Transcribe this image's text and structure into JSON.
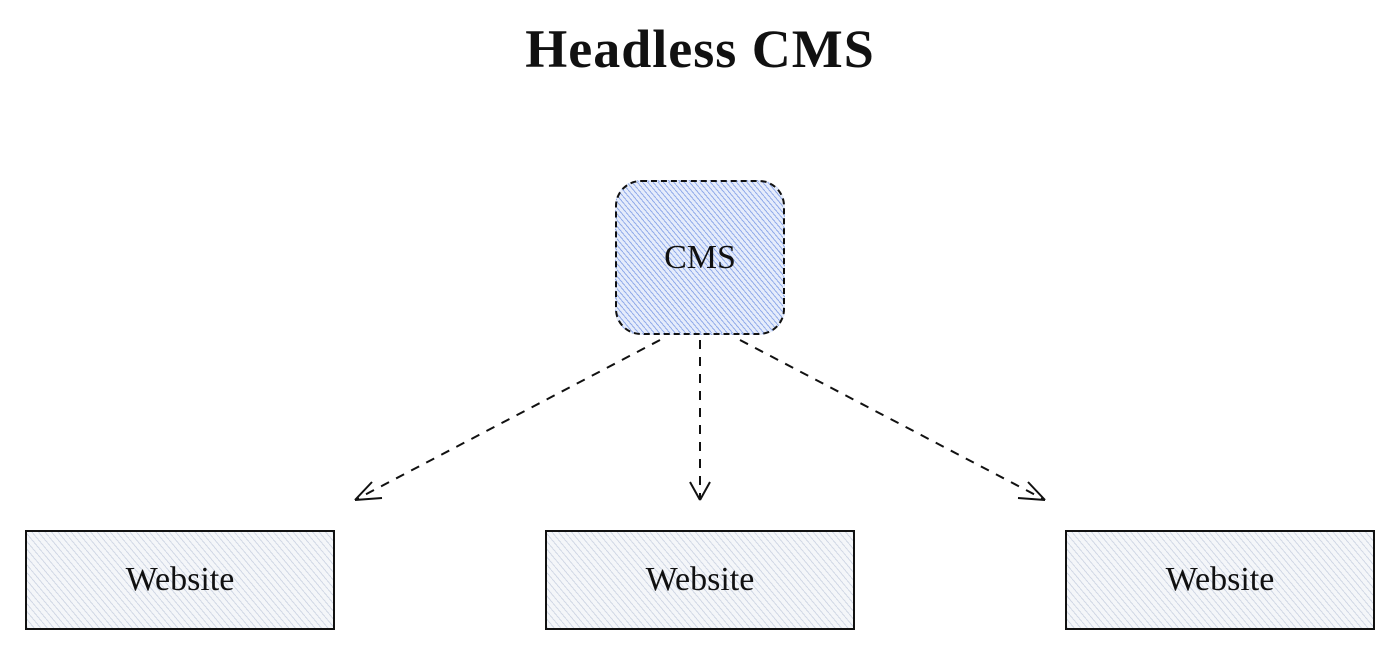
{
  "title": "Headless CMS",
  "nodes": {
    "cms": {
      "label": "CMS"
    },
    "websites": [
      {
        "label": "Website"
      },
      {
        "label": "Website"
      },
      {
        "label": "Website"
      }
    ]
  },
  "edges": [
    {
      "from": "cms",
      "to": "website-1"
    },
    {
      "from": "cms",
      "to": "website-2"
    },
    {
      "from": "cms",
      "to": "website-3"
    }
  ],
  "colors": {
    "cms_fill_hatch": "#5a78d8",
    "website_fill_hatch": "#8a9ab5",
    "stroke": "#111111",
    "background": "#ffffff"
  }
}
